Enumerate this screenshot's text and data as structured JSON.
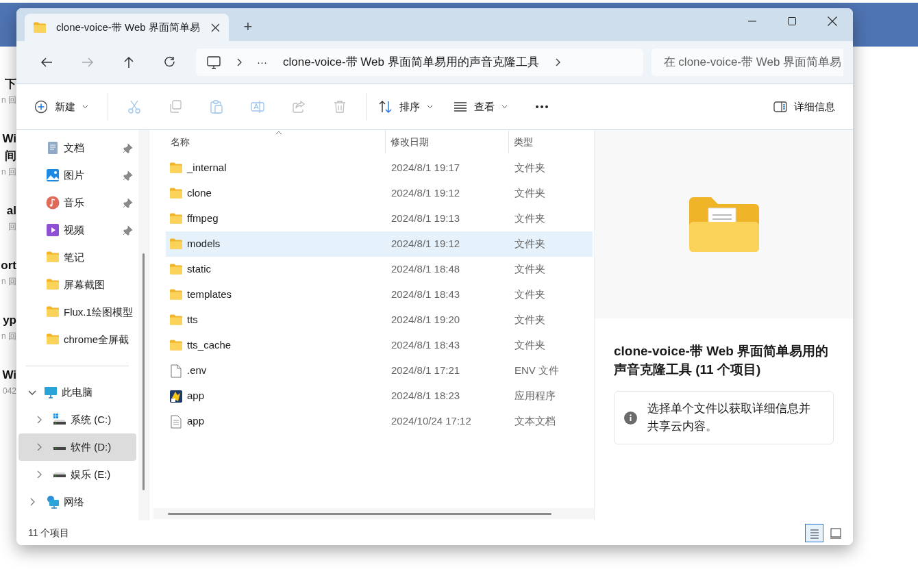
{
  "background_page": {
    "snippets": [
      {
        "lines": [
          "下"
        ],
        "meta": "n 回"
      },
      {
        "lines": [
          "Wi",
          "间"
        ],
        "meta": "n 回"
      },
      {
        "lines": [
          "al"
        ],
        "meta": "回"
      },
      {
        "lines": [
          "ort"
        ],
        "meta": "n 回"
      },
      {
        "lines": [
          "yp"
        ],
        "meta": "n 回"
      },
      {
        "lines": [
          "Wi"
        ],
        "meta": "042"
      }
    ]
  },
  "window": {
    "tabs": [
      {
        "label": "clone-voice-带 Web 界面简单易",
        "selected": true
      }
    ],
    "new_tab": "+",
    "nav": [
      {
        "kind": "back",
        "disabled": false
      },
      {
        "kind": "forward",
        "disabled": true
      },
      {
        "kind": "up",
        "disabled": false
      },
      {
        "kind": "refresh",
        "disabled": false
      }
    ],
    "address": {
      "overflow": "···",
      "path": "clone-voice-带 Web 界面简单易用的声音克隆工具"
    },
    "search": {
      "placeholder": "在 clone-voice-带 Web 界面简单易"
    },
    "commands": [
      {
        "kind": "new",
        "label": "新建",
        "dropdown": true,
        "disabled": false
      },
      {
        "kind": "cut",
        "disabled": true
      },
      {
        "kind": "copy",
        "disabled": true
      },
      {
        "kind": "paste",
        "disabled": true
      },
      {
        "kind": "rename",
        "disabled": true
      },
      {
        "kind": "share",
        "disabled": true
      },
      {
        "kind": "delete",
        "disabled": true
      },
      {
        "kind": "sort",
        "label": "排序",
        "dropdown": true,
        "disabled": false
      },
      {
        "kind": "view",
        "label": "查看",
        "dropdown": true,
        "disabled": false
      },
      {
        "kind": "more"
      }
    ],
    "details_toggle": "详细信息",
    "sidebar": {
      "quick_access": [
        {
          "label": "文档",
          "kind": "documents",
          "pinned": true
        },
        {
          "label": "图片",
          "kind": "pictures",
          "pinned": true
        },
        {
          "label": "音乐",
          "kind": "music",
          "pinned": true
        },
        {
          "label": "视频",
          "kind": "videos",
          "pinned": true
        },
        {
          "label": "笔记",
          "kind": "folder",
          "pinned": false
        },
        {
          "label": "屏幕截图",
          "kind": "folder",
          "pinned": false
        },
        {
          "label": "Flux.1绘图模型",
          "kind": "folder",
          "pinned": false
        },
        {
          "label": "chrome全屏截",
          "kind": "folder",
          "pinned": false
        }
      ],
      "tree": [
        {
          "label": "此电脑",
          "kind": "pc",
          "expanded": true,
          "selected": false,
          "children": [
            {
              "label": "系统 (C:)",
              "kind": "system-drive",
              "expanded": false,
              "selected": false
            },
            {
              "label": "软件 (D:)",
              "kind": "drive",
              "expanded": false,
              "selected": true
            },
            {
              "label": "娱乐 (E:)",
              "kind": "drive",
              "expanded": false,
              "selected": false
            }
          ]
        },
        {
          "label": "网络",
          "kind": "network",
          "expanded": false,
          "selected": false
        }
      ]
    },
    "files": {
      "columns": [
        {
          "label": "名称",
          "sorted": true
        },
        {
          "label": "修改日期",
          "sorted": false
        },
        {
          "label": "类型",
          "sorted": false
        }
      ],
      "rows": [
        {
          "name": "_internal",
          "date": "2024/8/1 19:17",
          "type": "文件夹",
          "kind": "folder",
          "selected": false
        },
        {
          "name": "clone",
          "date": "2024/8/1 19:12",
          "type": "文件夹",
          "kind": "folder",
          "selected": false
        },
        {
          "name": "ffmpeg",
          "date": "2024/8/1 19:13",
          "type": "文件夹",
          "kind": "folder",
          "selected": false
        },
        {
          "name": "models",
          "date": "2024/8/1 19:12",
          "type": "文件夹",
          "kind": "folder",
          "selected": true
        },
        {
          "name": "static",
          "date": "2024/8/1 18:48",
          "type": "文件夹",
          "kind": "folder",
          "selected": false
        },
        {
          "name": "templates",
          "date": "2024/8/1 18:43",
          "type": "文件夹",
          "kind": "folder",
          "selected": false
        },
        {
          "name": "tts",
          "date": "2024/8/1 19:20",
          "type": "文件夹",
          "kind": "folder",
          "selected": false
        },
        {
          "name": "tts_cache",
          "date": "2024/8/1 18:43",
          "type": "文件夹",
          "kind": "folder",
          "selected": false
        },
        {
          "name": ".env",
          "date": "2024/8/1 17:21",
          "type": "ENV 文件",
          "kind": "file",
          "selected": false
        },
        {
          "name": "app",
          "date": "2024/8/1 18:23",
          "type": "应用程序",
          "kind": "app",
          "selected": false
        },
        {
          "name": "app",
          "date": "2024/10/24 17:12",
          "type": "文本文档",
          "kind": "text",
          "selected": false
        }
      ]
    },
    "details": {
      "title": "clone-voice-带 Web 界面简单易用的声音克隆工具 (11 个项目)",
      "info": "选择单个文件以获取详细信息并共享云内容。"
    },
    "status_bar": {
      "count": "11 个项目",
      "view_modes": [
        {
          "kind": "details",
          "selected": true
        },
        {
          "kind": "tiles",
          "selected": false
        }
      ]
    }
  }
}
